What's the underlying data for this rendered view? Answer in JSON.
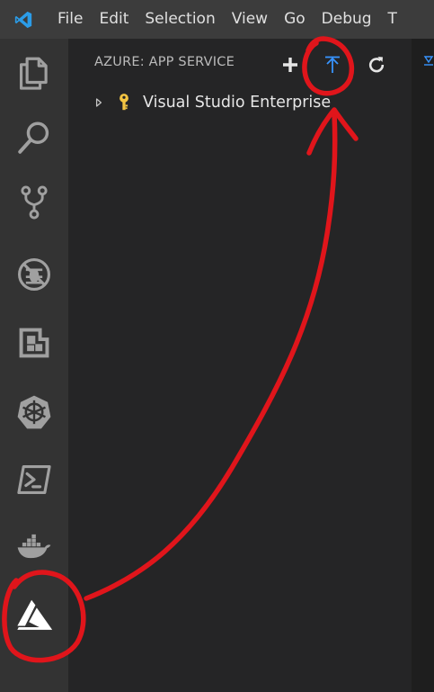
{
  "menu": {
    "items": [
      "File",
      "Edit",
      "Selection",
      "View",
      "Go",
      "Debug",
      "T"
    ]
  },
  "activity_bar": {
    "items": [
      {
        "icon": "explorer-icon"
      },
      {
        "icon": "search-icon"
      },
      {
        "icon": "source-control-icon"
      },
      {
        "icon": "debug-icon"
      },
      {
        "icon": "extensions-icon"
      },
      {
        "icon": "kubernetes-icon"
      },
      {
        "icon": "terminal-icon"
      },
      {
        "icon": "docker-icon"
      },
      {
        "icon": "azure-icon",
        "active": true
      }
    ]
  },
  "sidebar": {
    "title": "AZURE: APP SERVICE",
    "actions": [
      {
        "icon": "plus-icon"
      },
      {
        "icon": "deploy-icon"
      },
      {
        "icon": "refresh-icon"
      }
    ],
    "tree": [
      {
        "label": "Visual Studio Enterprise",
        "icon": "key-icon",
        "expanded": false
      }
    ]
  },
  "colors": {
    "menubar": "#3c3c3c",
    "activity_bar": "#333333",
    "sidebar": "#252526",
    "editor": "#1e1e1e",
    "accent_blue": "#3794ff",
    "key_yellow": "#f4c542",
    "annotation_red": "#e0151b"
  }
}
